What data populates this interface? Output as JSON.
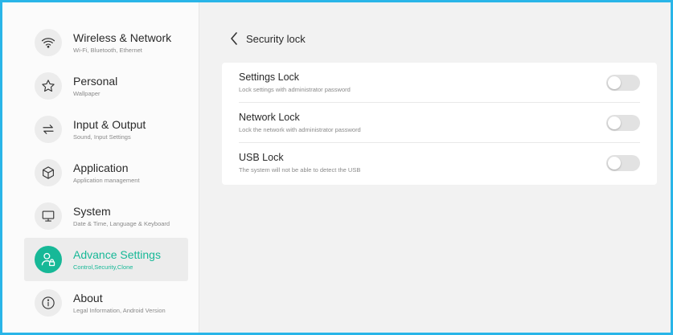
{
  "accent_color": "#17b897",
  "frame_color": "#29b5e8",
  "sidebar": {
    "items": [
      {
        "title": "Wireless & Network",
        "subtitle": "Wi-Fi, Bluetooth, Ethernet",
        "icon": "wifi-icon",
        "active": false
      },
      {
        "title": "Personal",
        "subtitle": "Wallpaper",
        "icon": "star-icon",
        "active": false
      },
      {
        "title": "Input & Output",
        "subtitle": "Sound, Input Settings",
        "icon": "swap-arrows-icon",
        "active": false
      },
      {
        "title": "Application",
        "subtitle": "Application management",
        "icon": "cube-icon",
        "active": false
      },
      {
        "title": "System",
        "subtitle": "Date & Time, Language & Keyboard",
        "icon": "monitor-icon",
        "active": false
      },
      {
        "title": "Advance Settings",
        "subtitle": "Control,Security,Clone",
        "icon": "user-lock-icon",
        "active": true
      },
      {
        "title": "About",
        "subtitle": "Legal Information, Android Version",
        "icon": "info-icon",
        "active": false
      }
    ]
  },
  "main": {
    "title": "Security lock",
    "settings": [
      {
        "title": "Settings Lock",
        "subtitle": "Lock settings with administrator password",
        "enabled": false
      },
      {
        "title": "Network Lock",
        "subtitle": "Lock the network with administrator password",
        "enabled": false
      },
      {
        "title": "USB Lock",
        "subtitle": "The system will not be able to detect the USB",
        "enabled": false
      }
    ]
  }
}
